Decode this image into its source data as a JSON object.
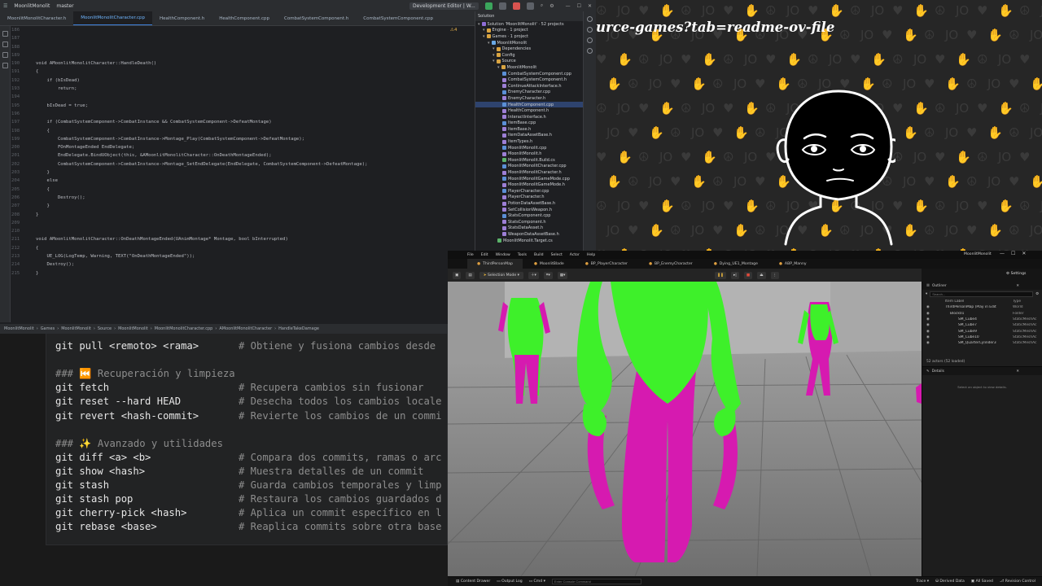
{
  "ide": {
    "title_items": [
      "MoonlitMonolit",
      "master",
      "Development Editor | W..."
    ],
    "tabs": [
      {
        "label": "MoonlitMonolitCharacter.h",
        "active": false
      },
      {
        "label": "MoonlitMonolitCharacter.cpp",
        "active": true
      },
      {
        "label": "HealthComponent.h",
        "active": false
      },
      {
        "label": "HealthComponent.cpp",
        "active": false
      },
      {
        "label": "CombatSystemComponent.h",
        "active": false
      },
      {
        "label": "CombatSystemComponent.cpp",
        "active": false
      }
    ],
    "warning_count": "4",
    "code_lines": [
      {
        "n": "186",
        "t": ""
      },
      {
        "n": "187",
        "t": ""
      },
      {
        "n": "188",
        "t": ""
      },
      {
        "n": "189",
        "t": ""
      },
      {
        "n": "190",
        "t": "void AMoonlitMonolitCharacter::HandleDeath()"
      },
      {
        "n": "191",
        "t": "{"
      },
      {
        "n": "192",
        "t": "    if (bIsDead)"
      },
      {
        "n": "193",
        "t": "        return;"
      },
      {
        "n": "194",
        "t": ""
      },
      {
        "n": "195",
        "t": "    bIsDead = true;"
      },
      {
        "n": "196",
        "t": ""
      },
      {
        "n": "197",
        "t": "    if (CombatSystemComponent->CombatInstance && CombatSystemComponent->DefeatMontage)"
      },
      {
        "n": "198",
        "t": "    {"
      },
      {
        "n": "199",
        "t": "        CombatSystemComponent->CombatInstance->Montage_Play(CombatSystemComponent->DefeatMontage);"
      },
      {
        "n": "200",
        "t": "        FOnMontageEnded EndDelegate;"
      },
      {
        "n": "201",
        "t": "        EndDelegate.BindUObject(this, &AMoonlitMonolitCharacter::OnDeathMontageEnded);"
      },
      {
        "n": "202",
        "t": "        CombatSystemComponent->CombatInstance->Montage_SetEndDelegate(EndDelegate, CombatSystemComponent->DefeatMontage);"
      },
      {
        "n": "203",
        "t": "    }"
      },
      {
        "n": "204",
        "t": "    else"
      },
      {
        "n": "205",
        "t": "    {"
      },
      {
        "n": "206",
        "t": "        Destroy();"
      },
      {
        "n": "207",
        "t": "    }"
      },
      {
        "n": "208",
        "t": "}"
      },
      {
        "n": "209",
        "t": ""
      },
      {
        "n": "210",
        "t": ""
      },
      {
        "n": "211",
        "t": "void AMoonlitMonolitCharacter::OnDeathMontageEnded(UAnimMontage* Montage, bool bInterrupted)"
      },
      {
        "n": "212",
        "t": "{"
      },
      {
        "n": "213",
        "t": "    UE_LOG(LogTemp, Warning, TEXT(\"OnDeathMontageEnded\"));"
      },
      {
        "n": "214",
        "t": "    Destroy();"
      },
      {
        "n": "215",
        "t": "}"
      }
    ],
    "breadcrumb": [
      "MoonlitMonolit",
      "Games",
      "MoonlitMonolit",
      "Source",
      "MoonlitMonolit",
      "MoonlitMonolitCharacter.cpp",
      "AMoonlitMonolitCharacter",
      "HandleTakeDamage"
    ],
    "solution": {
      "header": "Solution",
      "rows": [
        {
          "label": "Solution 'MoonlitMonolit' · 52 projects",
          "indent": 0,
          "kind": "sol"
        },
        {
          "label": "Engine · 1 project",
          "indent": 1,
          "kind": "folder"
        },
        {
          "label": "Games · 1 project",
          "indent": 1,
          "kind": "folder"
        },
        {
          "label": "MoonlitMonolit",
          "indent": 2,
          "kind": "proj"
        },
        {
          "label": "Dependencies",
          "indent": 3,
          "kind": "folder"
        },
        {
          "label": "Config",
          "indent": 3,
          "kind": "folder"
        },
        {
          "label": "Source",
          "indent": 3,
          "kind": "folder"
        },
        {
          "label": "MoonlitMonolit",
          "indent": 4,
          "kind": "folder"
        },
        {
          "label": "CombatSystemComponent.cpp",
          "indent": 5,
          "kind": "cpp"
        },
        {
          "label": "CombatSystemComponent.h",
          "indent": 5,
          "kind": "h"
        },
        {
          "label": "ContinueAttackInterface.h",
          "indent": 5,
          "kind": "h"
        },
        {
          "label": "EnemyCharacter.cpp",
          "indent": 5,
          "kind": "cpp"
        },
        {
          "label": "EnemyCharacter.h",
          "indent": 5,
          "kind": "h"
        },
        {
          "label": "HealthComponent.cpp",
          "indent": 5,
          "kind": "cpp",
          "selected": true
        },
        {
          "label": "HealthComponent.h",
          "indent": 5,
          "kind": "h"
        },
        {
          "label": "InteractInterface.h",
          "indent": 5,
          "kind": "h"
        },
        {
          "label": "ItemBase.cpp",
          "indent": 5,
          "kind": "cpp"
        },
        {
          "label": "ItemBase.h",
          "indent": 5,
          "kind": "h"
        },
        {
          "label": "ItemDataAssetBase.h",
          "indent": 5,
          "kind": "h"
        },
        {
          "label": "ItemTypes.h",
          "indent": 5,
          "kind": "h"
        },
        {
          "label": "MoonlitMonolit.cpp",
          "indent": 5,
          "kind": "cpp"
        },
        {
          "label": "MoonlitMonolit.h",
          "indent": 5,
          "kind": "h"
        },
        {
          "label": "MoonlitMonolit.Build.cs",
          "indent": 5,
          "kind": "cs"
        },
        {
          "label": "MoonlitMonolitCharacter.cpp",
          "indent": 5,
          "kind": "cpp"
        },
        {
          "label": "MoonlitMonolitCharacter.h",
          "indent": 5,
          "kind": "h"
        },
        {
          "label": "MoonlitMonolitGameMode.cpp",
          "indent": 5,
          "kind": "cpp"
        },
        {
          "label": "MoonlitMonolitGameMode.h",
          "indent": 5,
          "kind": "h"
        },
        {
          "label": "PlayerCharacter.cpp",
          "indent": 5,
          "kind": "cpp"
        },
        {
          "label": "PlayerCharacter.h",
          "indent": 5,
          "kind": "h"
        },
        {
          "label": "PotionDataAssetBase.h",
          "indent": 5,
          "kind": "h"
        },
        {
          "label": "SetCollisionWeapon.h",
          "indent": 5,
          "kind": "h"
        },
        {
          "label": "StatsComponent.cpp",
          "indent": 5,
          "kind": "cpp"
        },
        {
          "label": "StatsComponent.h",
          "indent": 5,
          "kind": "h"
        },
        {
          "label": "StatsDataAsset.h",
          "indent": 5,
          "kind": "h"
        },
        {
          "label": "WeaponDataAssetBase.h",
          "indent": 5,
          "kind": "h"
        },
        {
          "label": "MoonlitMonolit.Target.cs",
          "indent": 4,
          "kind": "cs"
        }
      ]
    }
  },
  "notes": {
    "lines": [
      {
        "cmd": "git pull <remoto> <rama>",
        "comment": "# Obtiene y fusiona cambios desde",
        "head": false
      },
      {
        "cmd": "",
        "comment": "",
        "head": false
      },
      {
        "cmd": "### ⏮️ Recuperación y limpieza",
        "comment": "",
        "head": true
      },
      {
        "cmd": "git fetch",
        "comment": "# Recupera cambios sin fusionar",
        "head": false
      },
      {
        "cmd": "git reset --hard HEAD",
        "comment": "# Desecha todos los cambios locale",
        "head": false
      },
      {
        "cmd": "git revert <hash-commit>",
        "comment": "# Revierte los cambios de un commi",
        "head": false
      },
      {
        "cmd": "",
        "comment": "",
        "head": false
      },
      {
        "cmd": "### ✨ Avanzado y utilidades",
        "comment": "",
        "head": true
      },
      {
        "cmd": "git diff <a> <b>",
        "comment": "# Compara dos commits, ramas o arc",
        "head": false
      },
      {
        "cmd": "git show <hash>",
        "comment": "# Muestra detalles de un commit",
        "head": false
      },
      {
        "cmd": "git stash",
        "comment": "# Guarda cambios temporales y limp",
        "head": false
      },
      {
        "cmd": "git stash pop",
        "comment": "# Restaura los cambios guardados d",
        "head": false
      },
      {
        "cmd": "git cherry-pick <hash>",
        "comment": "# Aplica un commit específico en l",
        "head": false
      },
      {
        "cmd": "git rebase <base>",
        "comment": "# Reaplica commits sobre otra base",
        "head": false
      }
    ]
  },
  "overlay": {
    "url_text": "urce-games?tab=readme-ov-file",
    "pattern_glyphs": [
      "☮",
      "JO",
      "♥",
      "✋"
    ]
  },
  "unreal": {
    "menu": [
      "File",
      "Edit",
      "Window",
      "Tools",
      "Build",
      "Select",
      "Actor",
      "Help"
    ],
    "project": "MoonlitMonolit",
    "tabs": [
      "ThirdPersonMap",
      "MoonlitBlade",
      "BP_PlayerCharacter",
      "BP_EnemyCharacter",
      "Dying_UE1_Montage",
      "ABP_Manny"
    ],
    "selection_mode": "Selection Mode",
    "settings_label": "Settings",
    "outliner": {
      "title": "Outliner",
      "search_placeholder": "Search...",
      "col_label": "Item Label",
      "col_type": "Type",
      "rows": [
        {
          "name": "ThirdPersonMap (Play in Edit",
          "type": "World"
        },
        {
          "name": "Block01",
          "type": "Folder"
        },
        {
          "name": "SM_Cube4",
          "type": "StaticMeshAc"
        },
        {
          "name": "SM_Cube7",
          "type": "StaticMeshAc"
        },
        {
          "name": "SM_Cube9",
          "type": "StaticMeshAc"
        },
        {
          "name": "SM_Cube10",
          "type": "StaticMeshAc"
        },
        {
          "name": "SM_QuarterCylinder3",
          "type": "StaticMeshAc"
        }
      ],
      "actor_count": "52 actors (52 loaded)"
    },
    "details": {
      "title": "Details",
      "empty_hint": "Select an object to view details."
    },
    "status": {
      "content_drawer": "Content Drawer",
      "output_log": "Output Log",
      "cmd": "Cmd",
      "cmd_placeholder": "Enter Console Command",
      "trace": "Trace",
      "derived_data": "Derived Data",
      "all_saved": "All Saved",
      "revision_control": "Revision Control"
    },
    "colors": {
      "accent_green": "#3ef02a",
      "accent_magenta": "#d61ab0"
    }
  }
}
